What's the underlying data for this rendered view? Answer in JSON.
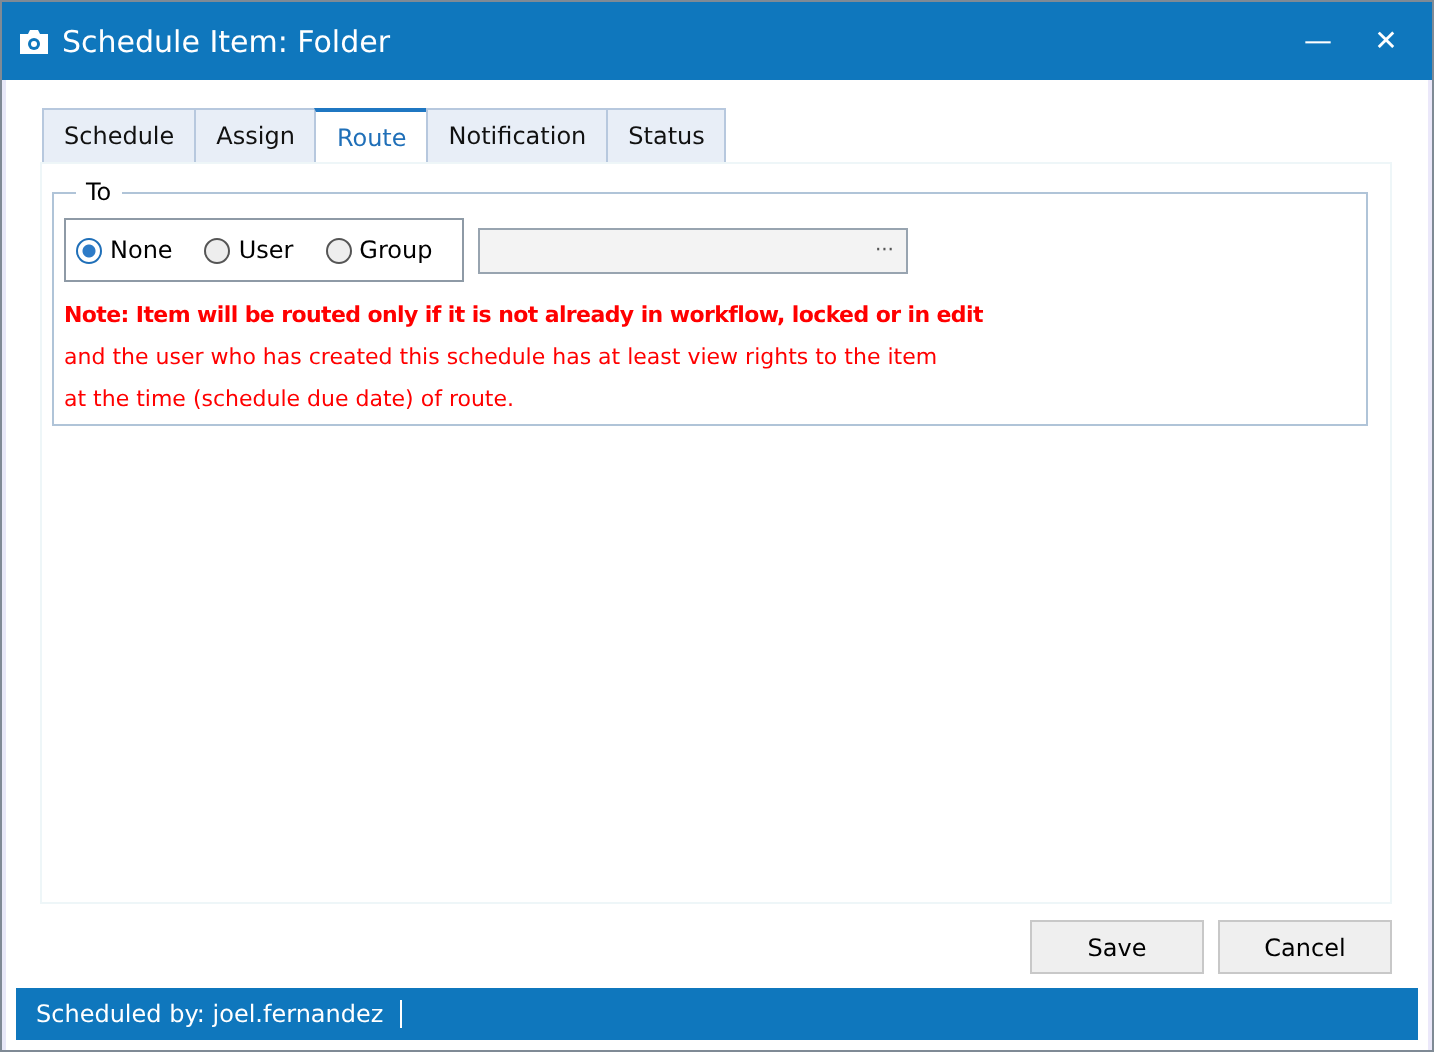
{
  "window": {
    "title": "Schedule Item: Folder",
    "minimize_glyph": "—",
    "close_glyph": "✕"
  },
  "tabs": [
    {
      "label": "Schedule",
      "selected": false
    },
    {
      "label": "Assign",
      "selected": false
    },
    {
      "label": "Route",
      "selected": true
    },
    {
      "label": "Notification",
      "selected": false
    },
    {
      "label": "Status",
      "selected": false
    }
  ],
  "to_group": {
    "legend": "To",
    "options": [
      {
        "label": "None",
        "selected": true
      },
      {
        "label": "User",
        "selected": false
      },
      {
        "label": "Group",
        "selected": false
      }
    ],
    "browse_glyph": "···",
    "notes": [
      {
        "text": "Note: Item will be routed only if it is not already in workflow, locked or in edit",
        "bold": true
      },
      {
        "text": "and the user who has created this schedule has at least view rights to the item",
        "bold": false
      },
      {
        "text": "at the time (schedule due date) of route.",
        "bold": false
      }
    ]
  },
  "buttons": [
    "Save",
    "Cancel"
  ],
  "status_bar": {
    "text": "Scheduled by: joel.fernandez"
  }
}
